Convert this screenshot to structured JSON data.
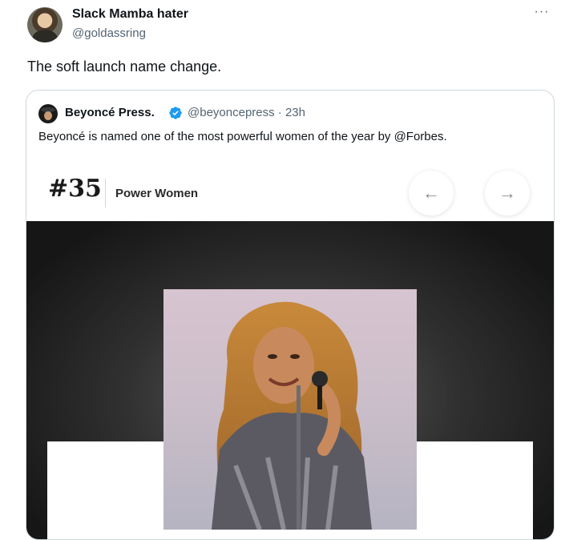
{
  "tweet": {
    "author_name": "Slack Mamba hater",
    "author_handle": "@goldassring",
    "more_label": "···",
    "text": "The soft launch name change."
  },
  "quote": {
    "author_name": "Beyoncé Press.",
    "author_handle": "@beyoncepress · 23h",
    "verified": true,
    "text": "Beyoncé is named one of the most powerful women of the year by @Forbes.",
    "card": {
      "rank": "#35",
      "list_name": "Power Women",
      "prev_arrow": "←",
      "next_arrow": "→"
    }
  },
  "colors": {
    "text": "#0f1419",
    "secondary_text": "#536471",
    "border": "#cfd9de",
    "verified_blue": "#1d9bf0"
  },
  "icons": {
    "verified": "verified-badge-icon",
    "more": "more-icon"
  }
}
